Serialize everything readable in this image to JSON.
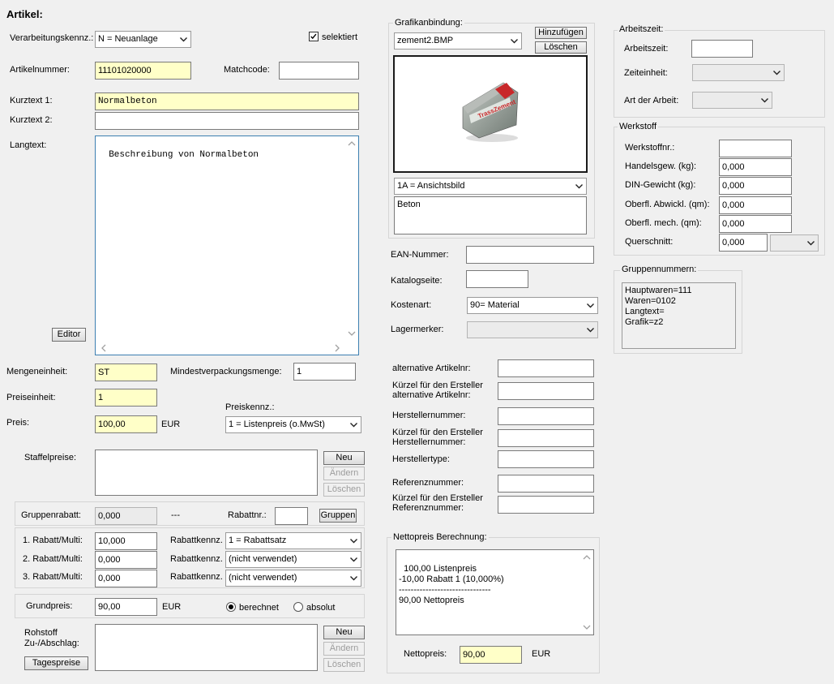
{
  "title": "Artikel:",
  "left": {
    "verarbeitung_label": "Verarbeitungskennz.:",
    "verarbeitung_value": "N = Neuanlage",
    "selektiert_label": "selektiert",
    "artikelnummer_label": "Artikelnummer:",
    "artikelnummer_value": "11101020000",
    "matchcode_label": "Matchcode:",
    "matchcode_value": "",
    "kurztext1_label": "Kurztext 1:",
    "kurztext1_value": "Normalbeton",
    "kurztext2_label": "Kurztext 2:",
    "kurztext2_value": "",
    "langtext_label": "Langtext:",
    "langtext_value": "Beschreibung von Normalbeton",
    "editor_button": "Editor",
    "mengeneinheit_label": "Mengeneinheit:",
    "mengeneinheit_value": "ST",
    "mindestverpackung_label": "Mindestverpackungsmenge:",
    "mindestverpackung_value": "1",
    "preiseinheit_label": "Preiseinheit:",
    "preiseinheit_value": "1",
    "preiskennz_label": "Preiskennz.:",
    "preiskennz_value": "1 = Listenpreis (o.MwSt)",
    "preis_label": "Preis:",
    "preis_value": "100,00",
    "preis_currency": "EUR",
    "staffelpreise_label": "Staffelpreise:",
    "neu_button": "Neu",
    "aendern_button": "Ändern",
    "loeschen_button": "Löschen",
    "gruppenrabatt_label": "Gruppenrabatt:",
    "gruppenrabatt_value": "0,000",
    "gruppenrabatt_dash": "---",
    "rabattnr_label": "Rabattnr.:",
    "rabattnr_value": "",
    "gruppen_button": "Gruppen",
    "rabatte": [
      {
        "label": "1. Rabatt/Multi:",
        "value": "10,000",
        "kennz_label": "Rabattkennz.",
        "kennz_value": "1 = Rabattsatz"
      },
      {
        "label": "2. Rabatt/Multi:",
        "value": "0,000",
        "kennz_label": "Rabattkennz.",
        "kennz_value": "(nicht verwendet)"
      },
      {
        "label": "3. Rabatt/Multi:",
        "value": "0,000",
        "kennz_label": "Rabattkennz.",
        "kennz_value": "(nicht verwendet)"
      }
    ],
    "grundpreis_label": "Grundpreis:",
    "grundpreis_value": "90,00",
    "grundpreis_currency": "EUR",
    "berechnet_label": "berechnet",
    "absolut_label": "absolut",
    "rohstoff_label": "Rohstoff\nZu-/Abschlag:",
    "tagespreise_button": "Tagespreise"
  },
  "middle": {
    "grafik_title": "Grafikanbindung:",
    "grafik_file": "zement2.BMP",
    "hinzufuegen_button": "Hinzufügen",
    "grafik_loeschen_button": "Löschen",
    "product_bag_text": "TrassZement",
    "bildart_value": "1A = Ansichtsbild",
    "bild_text": "Beton",
    "ean_label": "EAN-Nummer:",
    "ean_value": "",
    "katalogseite_label": "Katalogseite:",
    "katalogseite_value": "",
    "kostenart_label": "Kostenart:",
    "kostenart_value": "90= Material",
    "lagermerker_label": "Lagermerker:",
    "lagermerker_value": "",
    "alt_artikelnr_label": "alternative Artikelnr:",
    "kuerzel_alt_label": "Kürzel für den Ersteller\nalternative Artikelnr:",
    "herstellernummer_label": "Herstellernummer:",
    "kuerzel_hersteller_label": "Kürzel für den Ersteller\nHerstellernummer:",
    "herstellertype_label": "Herstellertype:",
    "referenznummer_label": "Referenznummer:",
    "kuerzel_referenz_label": "Kürzel für den Ersteller\nReferenznummer:",
    "netto_title": "Nettopreis Berechnung:",
    "netto_text": "100,00 Listenpreis\n-10,00 Rabatt 1 (10,000%)\n-------------------------------\n90,00 Nettopreis",
    "nettopreis_label": "Nettopreis:",
    "nettopreis_value": "90,00",
    "nettopreis_currency": "EUR"
  },
  "right": {
    "arbeitszeit_title": "Arbeitszeit:",
    "arbeitszeit_label": "Arbeitszeit:",
    "arbeitszeit_value": "",
    "zeiteinheit_label": "Zeiteinheit:",
    "zeiteinheit_value": "",
    "art_label": "Art der Arbeit:",
    "art_value": "",
    "werkstoff_title": "Werkstoff",
    "werkstoff_rows": [
      {
        "label": "Werkstoffnr.:",
        "value": ""
      },
      {
        "label": "Handelsgew. (kg):",
        "value": "0,000"
      },
      {
        "label": "DIN-Gewicht (kg):",
        "value": "0,000"
      },
      {
        "label": "Oberfl. Abwickl. (qm):",
        "value": "0,000"
      },
      {
        "label": "Oberfl. mech. (qm):",
        "value": "0,000"
      },
      {
        "label": "Querschnitt:",
        "value": "0,000"
      }
    ],
    "querschnitt_unit": "",
    "gruppen_title": "Gruppennummern:",
    "gruppen_text": "Hauptwaren=111\nWaren=0102\nLangtext=\nGrafik=z2"
  },
  "colors": {
    "required_field": "#ffffc8",
    "window_bg": "#f0f0f0",
    "focus_border": "#3c7fb1"
  },
  "icons": [
    "dropdown-arrow-icon",
    "checkbox-checked-icon",
    "radio-selected-icon",
    "radio-unselected-icon",
    "scroll-up-icon",
    "scroll-down-icon",
    "scroll-left-icon",
    "scroll-right-icon"
  ]
}
